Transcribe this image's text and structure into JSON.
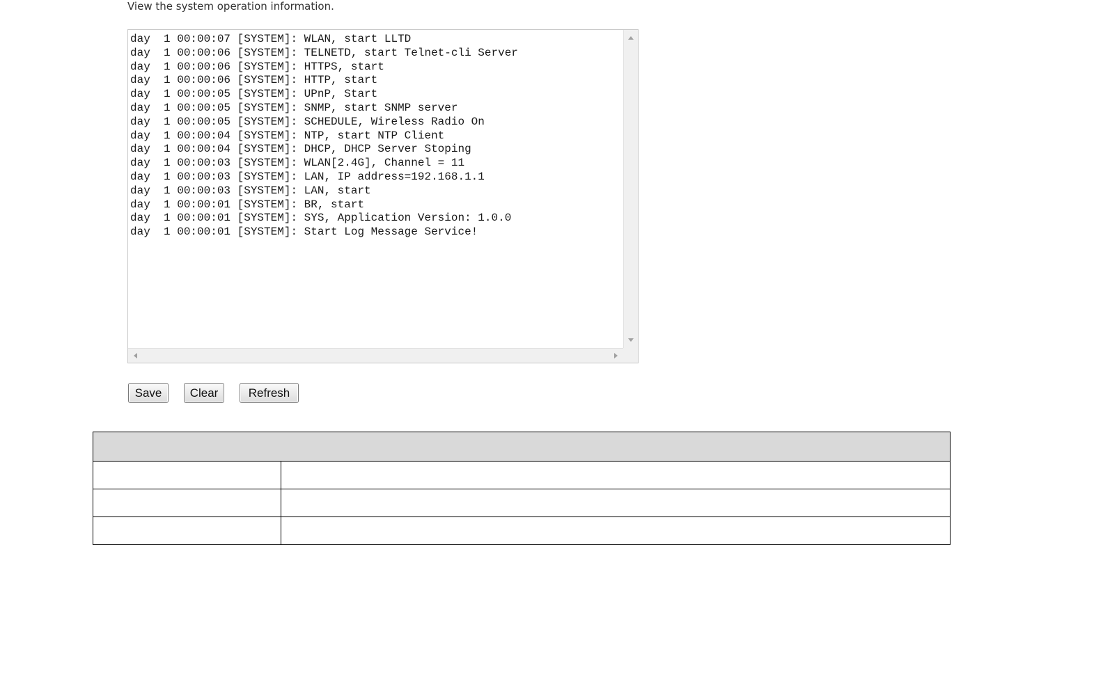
{
  "page": {
    "description": "View the system operation information."
  },
  "log": {
    "lines": [
      "day  1 00:00:07 [SYSTEM]: WLAN, start LLTD",
      "day  1 00:00:06 [SYSTEM]: TELNETD, start Telnet-cli Server",
      "day  1 00:00:06 [SYSTEM]: HTTPS, start",
      "day  1 00:00:06 [SYSTEM]: HTTP, start",
      "day  1 00:00:05 [SYSTEM]: UPnP, Start",
      "day  1 00:00:05 [SYSTEM]: SNMP, start SNMP server",
      "day  1 00:00:05 [SYSTEM]: SCHEDULE, Wireless Radio On",
      "day  1 00:00:04 [SYSTEM]: NTP, start NTP Client",
      "day  1 00:00:04 [SYSTEM]: DHCP, DHCP Server Stoping",
      "day  1 00:00:03 [SYSTEM]: WLAN[2.4G], Channel = 11",
      "day  1 00:00:03 [SYSTEM]: LAN, IP address=192.168.1.1",
      "day  1 00:00:03 [SYSTEM]: LAN, start",
      "day  1 00:00:01 [SYSTEM]: BR, start",
      "day  1 00:00:01 [SYSTEM]: SYS, Application Version: 1.0.0",
      "day  1 00:00:01 [SYSTEM]: Start Log Message Service!"
    ]
  },
  "buttons": {
    "save": "Save",
    "clear": "Clear",
    "refresh": "Refresh"
  },
  "table": {
    "header": "",
    "rows": [
      {
        "label": "",
        "value": ""
      },
      {
        "label": "",
        "value": ""
      },
      {
        "label": "",
        "value": ""
      }
    ]
  }
}
